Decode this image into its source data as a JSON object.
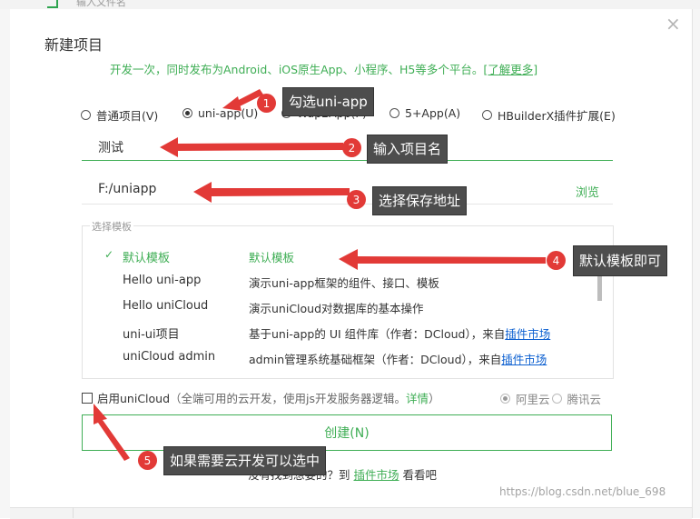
{
  "background": {
    "tab_text": "输入文件名"
  },
  "dialog": {
    "title": "新建项目",
    "close_glyph": "×",
    "subtitle": "开发一次，同时发布为Android、iOS原生App、小程序、H5等多个平台。",
    "subtitle_link": "[了解更多]",
    "project_types": [
      {
        "label": "普通项目(V)",
        "selected": false
      },
      {
        "label": "uni-app(U)",
        "selected": true
      },
      {
        "label": "Wap2App(P)",
        "selected": false
      },
      {
        "label": "5+App(A)",
        "selected": false
      },
      {
        "label": "HBuilderX插件扩展(E)",
        "selected": false
      }
    ],
    "project_name": "测试",
    "project_path": "F:/uniapp",
    "browse_label": "浏览",
    "template_legend": "选择模板",
    "templates": [
      {
        "check": "✓",
        "name": "默认模板",
        "desc": "默认模板",
        "link": ""
      },
      {
        "check": "",
        "name": "Hello uni-app",
        "desc": "演示uni-app框架的组件、接口、模板",
        "link": ""
      },
      {
        "check": "",
        "name": "Hello uniCloud",
        "desc": "演示uniCloud对数据库的基本操作",
        "link": ""
      },
      {
        "check": "",
        "name": "uni-ui项目",
        "desc": "基于uni-app的 UI 组件库（作者：DCloud），来自",
        "link": "插件市场"
      },
      {
        "check": "",
        "name": "uniCloud admin",
        "desc": "admin管理系统基础框架（作者：DCloud），来自",
        "link": "插件市场"
      }
    ],
    "cloud": {
      "label": "启用uniCloud",
      "desc": "（全端可用的云开发，使用js开发服务器逻辑。",
      "link": "详情",
      "close_paren": "）",
      "providers": [
        {
          "label": "阿里云",
          "selected": true
        },
        {
          "label": "腾讯云",
          "selected": false
        }
      ]
    },
    "create_label": "创建(N)",
    "footer": {
      "prefix": "没有找到想要的？到",
      "link": "插件市场",
      "suffix": "看看吧"
    }
  },
  "annotations": [
    {
      "num": "1",
      "text": "勾选uni-app"
    },
    {
      "num": "2",
      "text": "输入项目名"
    },
    {
      "num": "3",
      "text": "选择保存地址"
    },
    {
      "num": "4",
      "text": "默认模板即可"
    },
    {
      "num": "5",
      "text": "如果需要云开发可以选中"
    }
  ],
  "watermark": "https://blog.csdn.net/blue_698",
  "colors": {
    "accent": "#3fae55",
    "annotation_red": "#e23a37",
    "callout_bg": "#4d4d4d",
    "link_blue": "#0b5fd0"
  }
}
